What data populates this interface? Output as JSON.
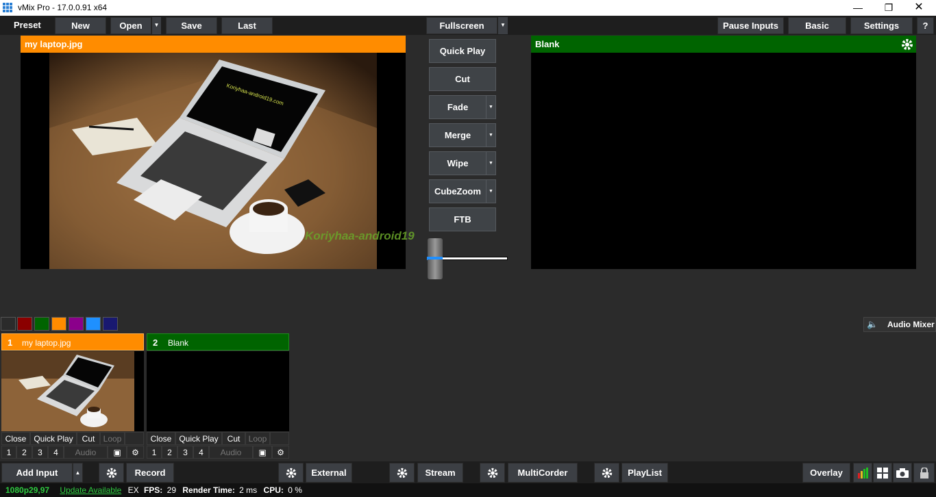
{
  "window": {
    "title": "vMix Pro - 17.0.0.91 x64"
  },
  "toolbar": {
    "preset": "Preset",
    "new": "New",
    "open": "Open",
    "save": "Save",
    "last": "Last",
    "fullscreen": "Fullscreen",
    "pause_inputs": "Pause Inputs",
    "basic": "Basic",
    "settings": "Settings",
    "help": "?"
  },
  "preview": {
    "title": "my laptop.jpg",
    "color": "#ff8c00"
  },
  "output": {
    "title": "Blank",
    "color": "#006400"
  },
  "preview_image_text": [
    "Koriyhaa-android19.com"
  ],
  "watermark": "Koriyhaa-android19",
  "transitions": [
    "Quick Play",
    "Cut",
    "Fade",
    "Merge",
    "Wipe",
    "CubeZoom",
    "FTB"
  ],
  "swatches": [
    "#2b2b2b",
    "#8b0000",
    "#006400",
    "#ff8c00",
    "#8b008b",
    "#1e90ff",
    "#191970"
  ],
  "audio_mixer": "Audio Mixer",
  "inputs": [
    {
      "num": "1",
      "name": "my laptop.jpg",
      "color": "#ff8c00",
      "row1": [
        "Close",
        "Quick Play",
        "Cut",
        "Loop"
      ],
      "row2": [
        "1",
        "2",
        "3",
        "4",
        "Audio"
      ]
    },
    {
      "num": "2",
      "name": "Blank",
      "color": "#006400",
      "row1": [
        "Close",
        "Quick Play",
        "Cut",
        "Loop"
      ],
      "row2": [
        "1",
        "2",
        "3",
        "4",
        "Audio"
      ]
    }
  ],
  "bottom": {
    "add_input": "Add Input",
    "record": "Record",
    "external": "External",
    "stream": "Stream",
    "multicorder": "MultiCorder",
    "playlist": "PlayList",
    "overlay": "Overlay"
  },
  "status": {
    "format": "1080p29,97",
    "update": "Update Available",
    "ex": "EX",
    "fps_label": "FPS:",
    "fps": "29",
    "render_label": "Render Time:",
    "render": "2 ms",
    "cpu_label": "CPU:",
    "cpu": "0 %"
  }
}
